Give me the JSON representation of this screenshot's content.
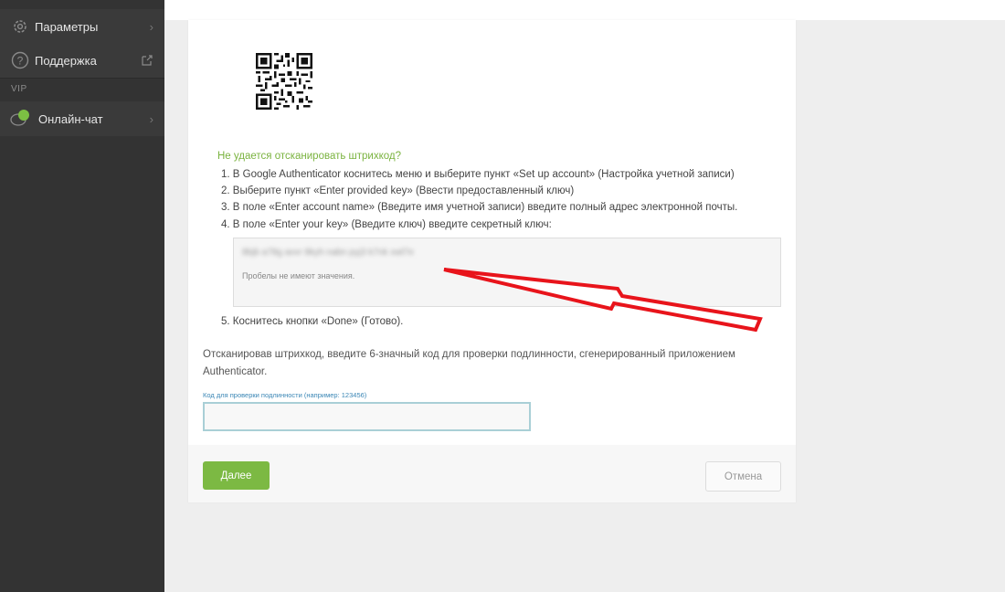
{
  "sidebar": {
    "items": [
      {
        "label": "Параметры",
        "icon": "gear-icon"
      },
      {
        "label": "Поддержка",
        "icon": "help-icon"
      }
    ],
    "section_label": "VIP",
    "chat": {
      "label": "Онлайн-чат",
      "icon": "chat-icon",
      "status_color": "#7cc043"
    }
  },
  "setup": {
    "hint_title": "Не удается отсканировать штрихкод?",
    "steps": [
      "1. В Google Authenticator коснитесь меню и выберите пункт «Set up account» (Настройка учетной записи)",
      "2. Выберите пункт «Enter provided key» (Ввести предоставленный ключ)",
      "3. В поле «Enter account name» (Введите имя учетной записи) введите полный адрес электронной почты.",
      "4. В поле «Enter your key» (Введите ключ) введите секретный ключ:"
    ],
    "secret_key": "8bjb a78g avvr 8kyh nabn pyj3 k7nk xwl7e",
    "key_note": "Пробелы не имеют значения.",
    "step5": "5. Коснитесь кнопки «Done» (Готово).",
    "description": "Отсканировав штрихкод, введите 6-значный код для проверки подлинности, сгенерированный приложением Authenticator.",
    "code_label": "Код для проверки подлинности (например: 123456)",
    "code_value": "",
    "code_placeholder": ""
  },
  "buttons": {
    "next": "Далее",
    "cancel": "Отмена"
  },
  "colors": {
    "accent_green": "#7cb943",
    "hint_green": "#7ab33f",
    "arrow_red": "#e8141b",
    "sidebar_bg": "#333333"
  }
}
